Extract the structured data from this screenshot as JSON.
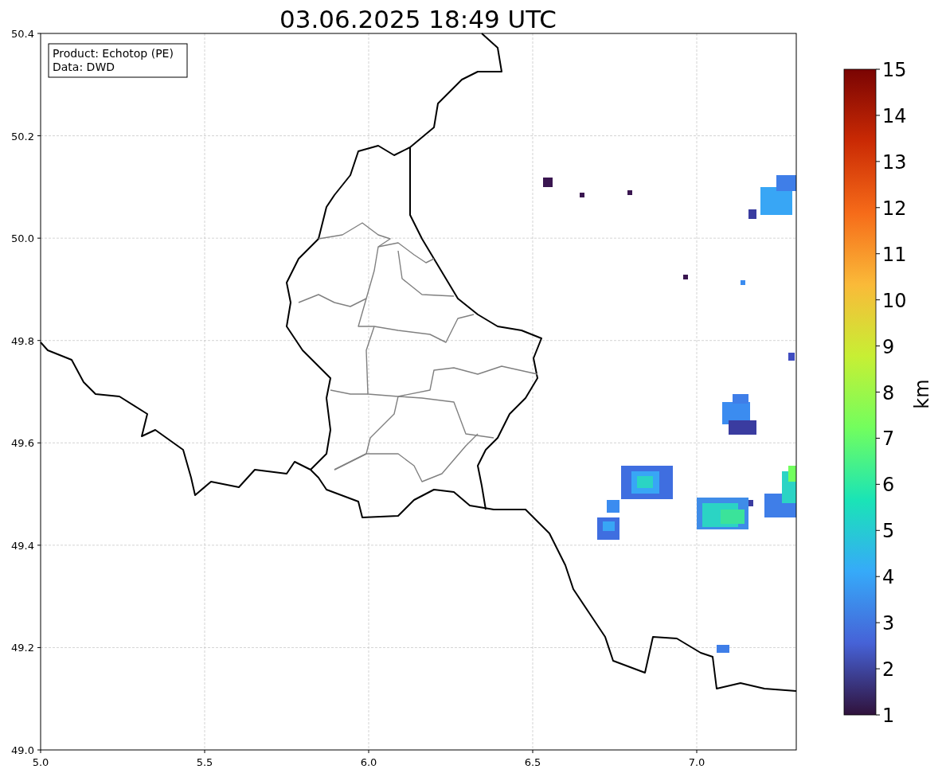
{
  "title": "03.06.2025 18:49 UTC",
  "info_box": {
    "lines": [
      "Product: Echotop (PE)",
      "Data: DWD"
    ]
  },
  "map": {
    "x_tick_labels": [
      "5.0",
      "5.5",
      "6.0",
      "6.5",
      "7.0"
    ],
    "y_tick_labels": [
      "50.4",
      "50.2",
      "50.0",
      "49.8",
      "49.6",
      "49.4",
      "49.2",
      "49.0"
    ]
  },
  "colorbar": {
    "tick_labels": [
      "15",
      "14",
      "13",
      "12",
      "11",
      "10",
      "9",
      "8",
      "7",
      "6",
      "5",
      "4",
      "3",
      "2",
      "1"
    ],
    "label": "km"
  }
}
